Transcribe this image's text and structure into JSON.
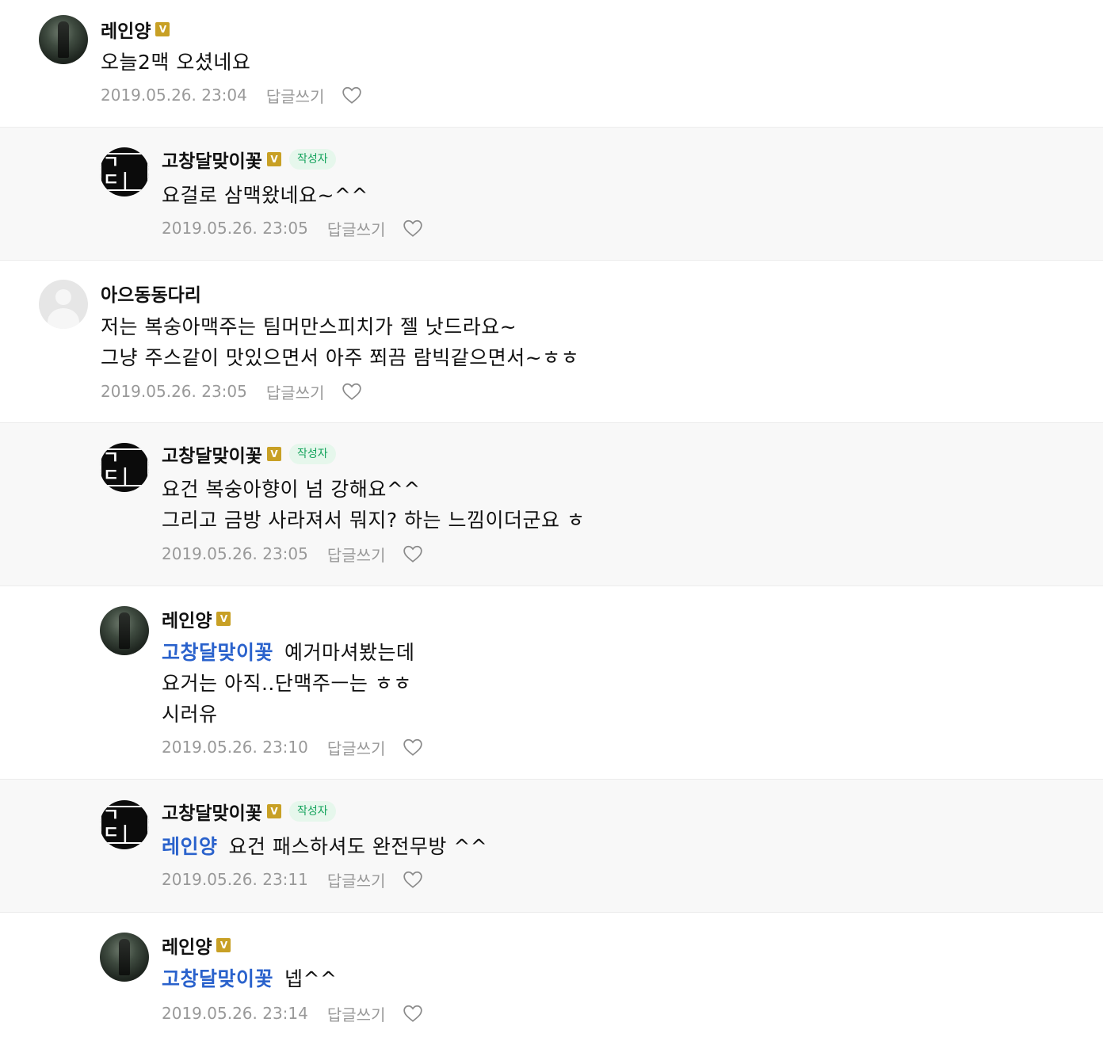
{
  "comments": [
    {
      "nickname": "레인양",
      "verified": "V",
      "avatar": "profile-photo",
      "lines": [
        "오늘2맥 오셨네요"
      ],
      "timestamp": "2019.05.26. 23:04",
      "reply_label": "답글쓰기",
      "like_icon": "heart-outline-icon"
    },
    {
      "nickname": "고창달맞이꽃",
      "verified": "V",
      "author_badge": "작성자",
      "avatar": "logo",
      "avatar_text": "ㄱㄷ|",
      "lines": [
        "요걸로 삼맥왔네요~^^"
      ],
      "timestamp": "2019.05.26. 23:05",
      "reply_label": "답글쓰기",
      "like_icon": "heart-outline-icon"
    },
    {
      "nickname": "아으동동다리",
      "avatar": "default-profile",
      "lines": [
        "저는 복숭아맥주는 팀머만스피치가 젤 낫드라요~",
        "그냥 주스같이 맛있으면서 아주 쬐끔 람빅같으면서~ㅎㅎ"
      ],
      "timestamp": "2019.05.26. 23:05",
      "reply_label": "답글쓰기",
      "like_icon": "heart-outline-icon"
    },
    {
      "nickname": "고창달맞이꽃",
      "verified": "V",
      "author_badge": "작성자",
      "avatar": "logo",
      "avatar_text": "ㄱㄷ|",
      "lines": [
        "요건 복숭아향이 넘 강해요^^",
        "그리고 금방 사라져서 뭐지? 하는 느낌이더군요 ㅎ"
      ],
      "timestamp": "2019.05.26. 23:05",
      "reply_label": "답글쓰기",
      "like_icon": "heart-outline-icon"
    },
    {
      "nickname": "레인양",
      "verified": "V",
      "avatar": "profile-photo",
      "mention": "고창달맞이꽃",
      "lines": [
        "예거마셔봤는데",
        "요거는 아직..단맥주ㅡ는 ㅎㅎ",
        "시러유"
      ],
      "timestamp": "2019.05.26. 23:10",
      "reply_label": "답글쓰기",
      "like_icon": "heart-outline-icon"
    },
    {
      "nickname": "고창달맞이꽃",
      "verified": "V",
      "author_badge": "작성자",
      "avatar": "logo",
      "avatar_text": "ㄱㄷ|",
      "mention": "레인양",
      "lines": [
        "요건 패스하셔도 완전무방 ^^"
      ],
      "timestamp": "2019.05.26. 23:11",
      "reply_label": "답글쓰기",
      "like_icon": "heart-outline-icon"
    },
    {
      "nickname": "레인양",
      "verified": "V",
      "avatar": "profile-photo",
      "mention": "고창달맞이꽃",
      "lines": [
        "넵^^"
      ],
      "timestamp": "2019.05.26. 23:14",
      "reply_label": "답글쓰기",
      "like_icon": "heart-outline-icon"
    }
  ],
  "colors": {
    "mention": "#2a62cc",
    "verified_badge": "#c8a025",
    "author_badge_text": "#14a35c",
    "author_badge_bg": "#e6f7ec",
    "meta_text": "#999999",
    "reply_bg": "#f8f8f8"
  }
}
